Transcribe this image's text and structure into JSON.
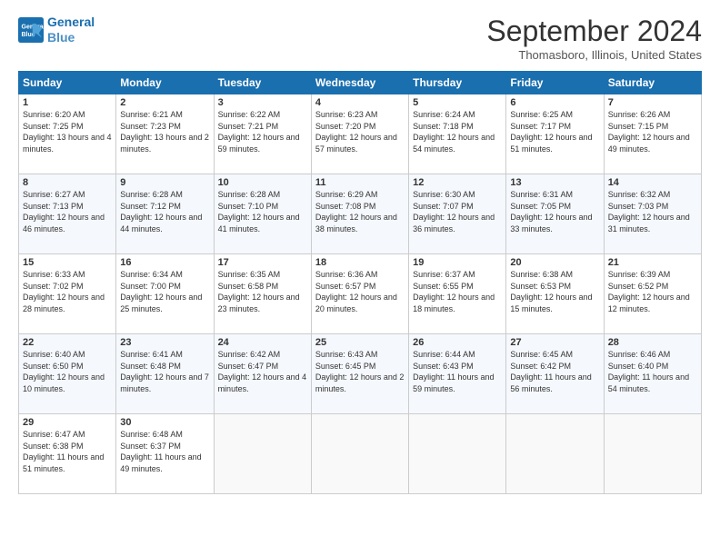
{
  "header": {
    "logo_line1": "General",
    "logo_line2": "Blue",
    "month_year": "September 2024",
    "location": "Thomasboro, Illinois, United States"
  },
  "days_of_week": [
    "Sunday",
    "Monday",
    "Tuesday",
    "Wednesday",
    "Thursday",
    "Friday",
    "Saturday"
  ],
  "weeks": [
    [
      {
        "day": "1",
        "sunrise": "6:20 AM",
        "sunset": "7:25 PM",
        "daylight": "13 hours and 4 minutes."
      },
      {
        "day": "2",
        "sunrise": "6:21 AM",
        "sunset": "7:23 PM",
        "daylight": "13 hours and 2 minutes."
      },
      {
        "day": "3",
        "sunrise": "6:22 AM",
        "sunset": "7:21 PM",
        "daylight": "12 hours and 59 minutes."
      },
      {
        "day": "4",
        "sunrise": "6:23 AM",
        "sunset": "7:20 PM",
        "daylight": "12 hours and 57 minutes."
      },
      {
        "day": "5",
        "sunrise": "6:24 AM",
        "sunset": "7:18 PM",
        "daylight": "12 hours and 54 minutes."
      },
      {
        "day": "6",
        "sunrise": "6:25 AM",
        "sunset": "7:17 PM",
        "daylight": "12 hours and 51 minutes."
      },
      {
        "day": "7",
        "sunrise": "6:26 AM",
        "sunset": "7:15 PM",
        "daylight": "12 hours and 49 minutes."
      }
    ],
    [
      {
        "day": "8",
        "sunrise": "6:27 AM",
        "sunset": "7:13 PM",
        "daylight": "12 hours and 46 minutes."
      },
      {
        "day": "9",
        "sunrise": "6:28 AM",
        "sunset": "7:12 PM",
        "daylight": "12 hours and 44 minutes."
      },
      {
        "day": "10",
        "sunrise": "6:28 AM",
        "sunset": "7:10 PM",
        "daylight": "12 hours and 41 minutes."
      },
      {
        "day": "11",
        "sunrise": "6:29 AM",
        "sunset": "7:08 PM",
        "daylight": "12 hours and 38 minutes."
      },
      {
        "day": "12",
        "sunrise": "6:30 AM",
        "sunset": "7:07 PM",
        "daylight": "12 hours and 36 minutes."
      },
      {
        "day": "13",
        "sunrise": "6:31 AM",
        "sunset": "7:05 PM",
        "daylight": "12 hours and 33 minutes."
      },
      {
        "day": "14",
        "sunrise": "6:32 AM",
        "sunset": "7:03 PM",
        "daylight": "12 hours and 31 minutes."
      }
    ],
    [
      {
        "day": "15",
        "sunrise": "6:33 AM",
        "sunset": "7:02 PM",
        "daylight": "12 hours and 28 minutes."
      },
      {
        "day": "16",
        "sunrise": "6:34 AM",
        "sunset": "7:00 PM",
        "daylight": "12 hours and 25 minutes."
      },
      {
        "day": "17",
        "sunrise": "6:35 AM",
        "sunset": "6:58 PM",
        "daylight": "12 hours and 23 minutes."
      },
      {
        "day": "18",
        "sunrise": "6:36 AM",
        "sunset": "6:57 PM",
        "daylight": "12 hours and 20 minutes."
      },
      {
        "day": "19",
        "sunrise": "6:37 AM",
        "sunset": "6:55 PM",
        "daylight": "12 hours and 18 minutes."
      },
      {
        "day": "20",
        "sunrise": "6:38 AM",
        "sunset": "6:53 PM",
        "daylight": "12 hours and 15 minutes."
      },
      {
        "day": "21",
        "sunrise": "6:39 AM",
        "sunset": "6:52 PM",
        "daylight": "12 hours and 12 minutes."
      }
    ],
    [
      {
        "day": "22",
        "sunrise": "6:40 AM",
        "sunset": "6:50 PM",
        "daylight": "12 hours and 10 minutes."
      },
      {
        "day": "23",
        "sunrise": "6:41 AM",
        "sunset": "6:48 PM",
        "daylight": "12 hours and 7 minutes."
      },
      {
        "day": "24",
        "sunrise": "6:42 AM",
        "sunset": "6:47 PM",
        "daylight": "12 hours and 4 minutes."
      },
      {
        "day": "25",
        "sunrise": "6:43 AM",
        "sunset": "6:45 PM",
        "daylight": "12 hours and 2 minutes."
      },
      {
        "day": "26",
        "sunrise": "6:44 AM",
        "sunset": "6:43 PM",
        "daylight": "11 hours and 59 minutes."
      },
      {
        "day": "27",
        "sunrise": "6:45 AM",
        "sunset": "6:42 PM",
        "daylight": "11 hours and 56 minutes."
      },
      {
        "day": "28",
        "sunrise": "6:46 AM",
        "sunset": "6:40 PM",
        "daylight": "11 hours and 54 minutes."
      }
    ],
    [
      {
        "day": "29",
        "sunrise": "6:47 AM",
        "sunset": "6:38 PM",
        "daylight": "11 hours and 51 minutes."
      },
      {
        "day": "30",
        "sunrise": "6:48 AM",
        "sunset": "6:37 PM",
        "daylight": "11 hours and 49 minutes."
      },
      null,
      null,
      null,
      null,
      null
    ]
  ]
}
